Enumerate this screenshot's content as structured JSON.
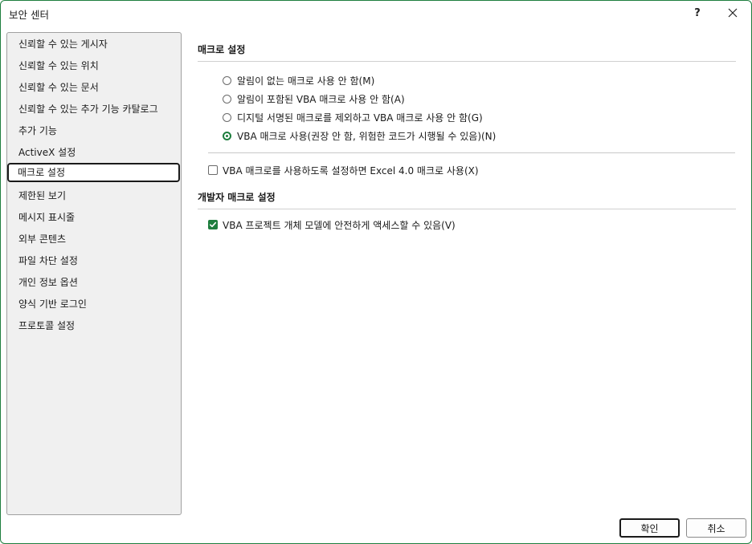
{
  "window": {
    "title": "보안 센터",
    "help_label": "?"
  },
  "sidebar": {
    "items": [
      {
        "label": "신뢰할 수 있는 게시자"
      },
      {
        "label": "신뢰할 수 있는 위치"
      },
      {
        "label": "신뢰할 수 있는 문서"
      },
      {
        "label": "신뢰할 수 있는 추가 기능 카탈로그"
      },
      {
        "label": "추가 기능"
      },
      {
        "label": "ActiveX 설정"
      },
      {
        "label": "매크로 설정",
        "selected": true
      },
      {
        "label": "제한된 보기"
      },
      {
        "label": "메시지 표시줄"
      },
      {
        "label": "외부 콘텐츠"
      },
      {
        "label": "파일 차단 설정"
      },
      {
        "label": "개인 정보 옵션"
      },
      {
        "label": "양식 기반 로그인"
      },
      {
        "label": "프로토콜 설정"
      }
    ]
  },
  "macro_settings": {
    "header": "매크로 설정",
    "options": [
      {
        "label": "알림이 없는 매크로 사용 안 함(M)",
        "checked": false
      },
      {
        "label": "알림이 포함된 VBA 매크로 사용 안 함(A)",
        "checked": false
      },
      {
        "label": "디지털 서명된 매크로를 제외하고 VBA 매크로 사용 안 함(G)",
        "checked": false
      },
      {
        "label": "VBA 매크로 사용(권장 안 함, 위험한 코드가 시행될 수 있음)(N)",
        "checked": true
      }
    ],
    "excel4_checkbox": {
      "label": "VBA 매크로를 사용하도록 설정하면 Excel 4.0 매크로 사용(X)",
      "checked": false
    }
  },
  "developer_settings": {
    "header": "개발자 매크로 설정",
    "vba_access": {
      "label": "VBA 프로젝트 개체 모델에 안전하게 액세스할 수 있음(V)",
      "checked": true
    }
  },
  "buttons": {
    "ok": "확인",
    "cancel": "취소"
  },
  "colors": {
    "accent": "#1e7e3e",
    "sidebar_bg": "#f0f0f0"
  }
}
